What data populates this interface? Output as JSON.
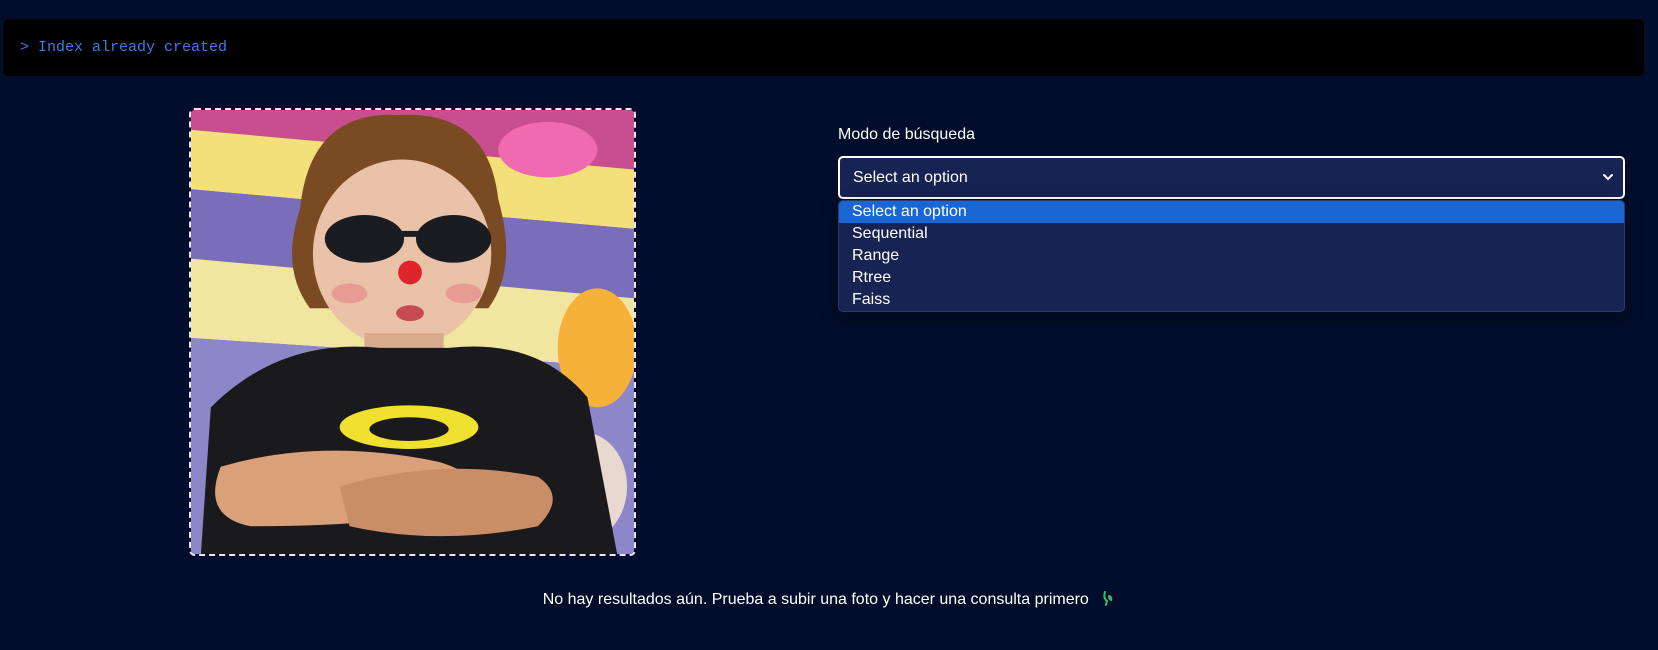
{
  "console": {
    "prompt": ">",
    "message": "Index already created"
  },
  "upload": {
    "image_description": "uploaded-photo"
  },
  "search_mode": {
    "label": "Modo de búsqueda",
    "selected": "Select an option",
    "options": [
      "Select an option",
      "Sequential",
      "Range",
      "Rtree",
      "Faiss"
    ],
    "highlighted_index": 0
  },
  "results": {
    "empty_message": "No hay resultados aún. Prueba a subir una foto y hacer una consulta primero"
  },
  "colors": {
    "background": "#010d2a",
    "console_bg": "#000000",
    "console_text": "#3d7be8",
    "select_bg": "#172353",
    "highlight": "#1a66d2"
  },
  "icons": {
    "chevron": "chevron-down-icon",
    "leaf": "leaf-icon"
  }
}
